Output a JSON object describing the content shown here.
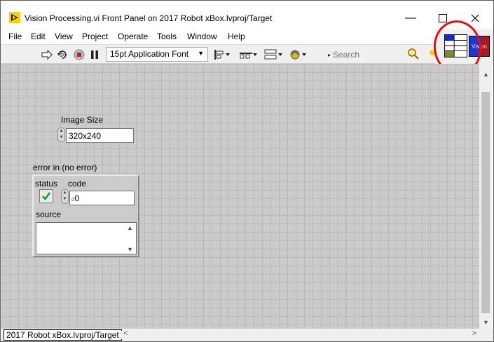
{
  "window": {
    "title": "Vision Processing.vi Front Panel on 2017 Robot xBox.lvproj/Target",
    "controls": {
      "minimize": "—",
      "maximize": "☐",
      "close": "✕"
    }
  },
  "menu": [
    {
      "label": "File"
    },
    {
      "label": "Edit"
    },
    {
      "label": "View"
    },
    {
      "label": "Project"
    },
    {
      "label": "Operate"
    },
    {
      "label": "Tools"
    },
    {
      "label": "Window"
    },
    {
      "label": "Help"
    }
  ],
  "toolbar": {
    "run_icon": "run-arrow-icon",
    "run_continuous_icon": "run-continuously-icon",
    "abort_icon": "abort-icon",
    "pause_icon": "pause-icon",
    "font": "15pt Application Font",
    "align_icon": "align-objects-icon",
    "distribute_icon": "distribute-objects-icon",
    "resize_icon": "resize-objects-icon",
    "reorder_icon": "reorder-icon",
    "search_placeholder": "Search"
  },
  "connector": {
    "vi_icon_text": "Vision",
    "vi_icon_color": "#2038c8",
    "highlight_color": "#e31010"
  },
  "panel": {
    "image_size": {
      "label": "Image Size",
      "value": "320x240"
    },
    "error_in": {
      "label": "error in (no error)",
      "status_label": "status",
      "code_label": "code",
      "code_value": "0",
      "source_label": "source",
      "source_value": ""
    }
  },
  "status": {
    "context": "2017 Robot xBox.lvproj/Target"
  }
}
